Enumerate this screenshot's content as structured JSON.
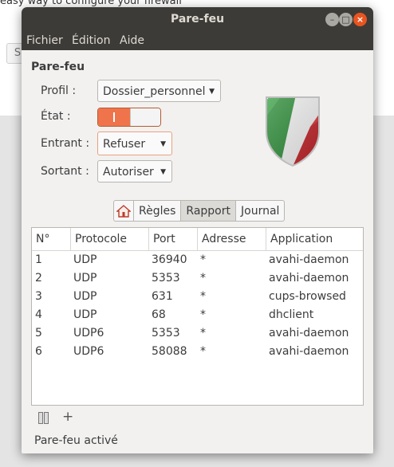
{
  "background": {
    "text": "easy way to configure your firewall",
    "button_letter": "S"
  },
  "window": {
    "title": "Pare-feu",
    "controls": {
      "minimize": "–",
      "maximize": "□",
      "close": "×"
    }
  },
  "menu": [
    "Fichier",
    "Édition",
    "Aide"
  ],
  "firewall": {
    "section_title": "Pare-feu",
    "profile_label": "Profil :",
    "profile_value": "Dossier_personnel",
    "state_label": "État :",
    "state_on": true,
    "incoming_label": "Entrant :",
    "incoming_value": "Refuser",
    "outgoing_label": "Sortant :",
    "outgoing_value": "Autoriser"
  },
  "tabs": {
    "home_icon": "home-icon",
    "items": [
      "Règles",
      "Rapport",
      "Journal"
    ],
    "active": "Rapport"
  },
  "report": {
    "columns": [
      "N°",
      "Protocole",
      "Port",
      "Adresse",
      "Application"
    ],
    "rows": [
      [
        "1",
        "UDP",
        "36940",
        "*",
        "avahi-daemon"
      ],
      [
        "2",
        "UDP",
        "5353",
        "*",
        "avahi-daemon"
      ],
      [
        "3",
        "UDP",
        "631",
        "*",
        "cups-browsed"
      ],
      [
        "4",
        "UDP",
        "68",
        "*",
        "dhclient"
      ],
      [
        "5",
        "UDP6",
        "5353",
        "*",
        "avahi-daemon"
      ],
      [
        "6",
        "UDP6",
        "58088",
        "*",
        "avahi-daemon"
      ]
    ]
  },
  "toolbar": {
    "plus_label": "+"
  },
  "status": "Pare-feu activé",
  "colors": {
    "accent": "#f0744b",
    "titlebar": "#3c3b37",
    "close": "#e95420"
  }
}
